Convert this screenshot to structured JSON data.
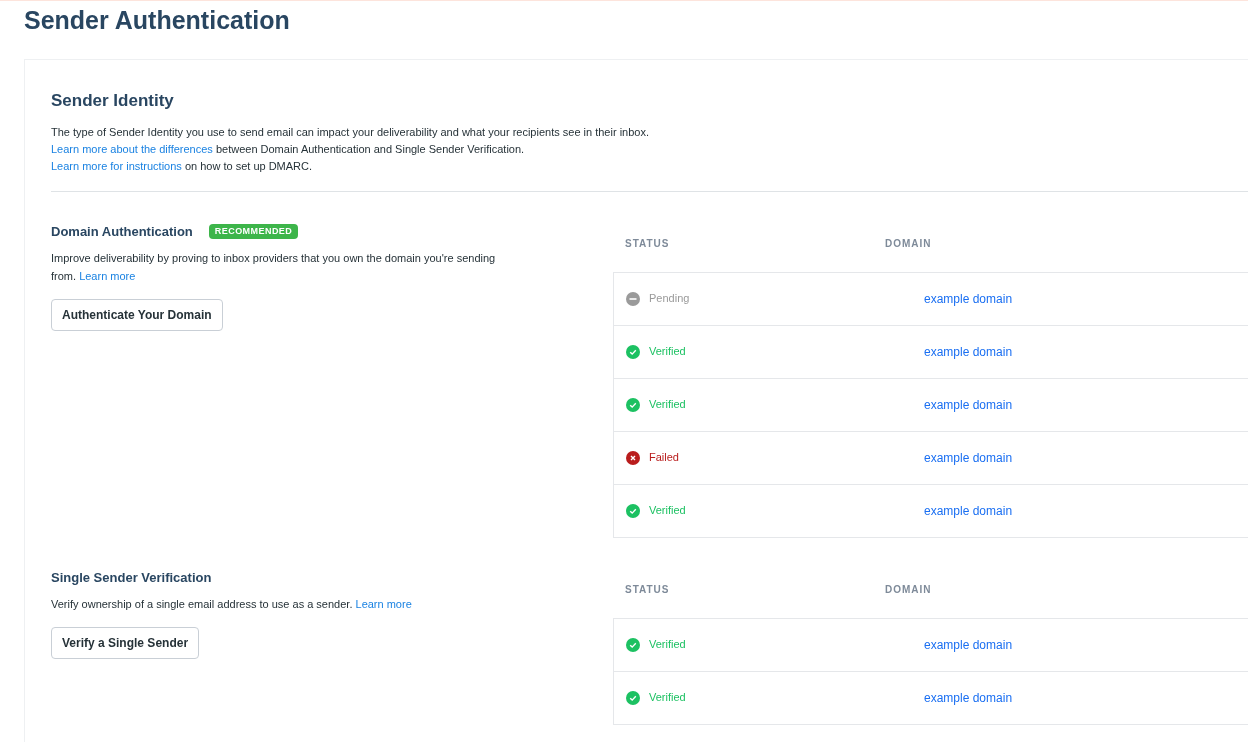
{
  "page_title": "Sender Authentication",
  "sender_identity": {
    "title": "Sender Identity",
    "lines": [
      {
        "text": "The type of Sender Identity you use to send email can impact your deliverability and what your recipients see in their inbox."
      },
      {
        "link": "Learn more about the differences",
        "text": " between Domain Authentication and Single Sender Verification."
      },
      {
        "link": "Learn more for instructions",
        "text": " on how to set up DMARC."
      }
    ]
  },
  "sections": [
    {
      "title": "Domain Authentication",
      "badge": "RECOMMENDED",
      "description": "Improve deliverability by proving to inbox providers that you own the domain you're sending from.",
      "link": "Learn more",
      "button": "Authenticate Your Domain",
      "columns": [
        "STATUS",
        "DOMAIN"
      ],
      "rows": [
        {
          "kind": "pending",
          "status": "Pending",
          "domain": "example domain"
        },
        {
          "kind": "verified",
          "status": "Verified",
          "domain": "example domain"
        },
        {
          "kind": "verified",
          "status": "Verified",
          "domain": "example domain"
        },
        {
          "kind": "failed",
          "status": "Failed",
          "domain": "example domain"
        },
        {
          "kind": "verified",
          "status": "Verified",
          "domain": "example domain"
        }
      ]
    },
    {
      "title": "Single Sender Verification",
      "description": "Verify ownership of a single email address to use as a sender.",
      "link": "Learn more",
      "button": "Verify a Single Sender",
      "columns": [
        "STATUS",
        "DOMAIN"
      ],
      "rows": [
        {
          "kind": "verified",
          "status": "Verified",
          "domain": "example domain"
        },
        {
          "kind": "verified",
          "status": "Verified",
          "domain": "example domain"
        }
      ]
    }
  ]
}
